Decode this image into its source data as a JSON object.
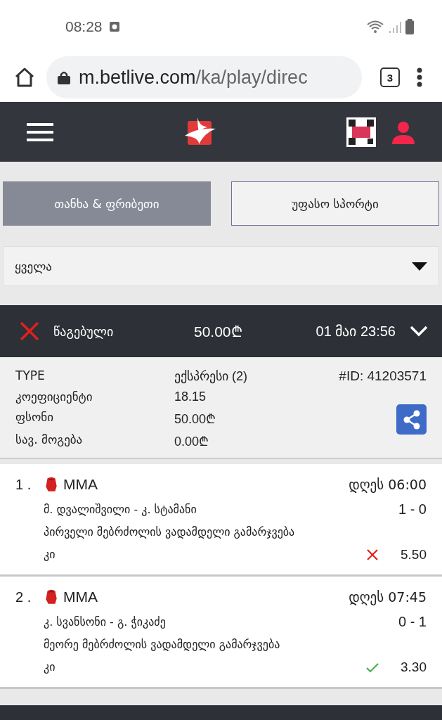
{
  "status_bar": {
    "time": "08:28"
  },
  "browser": {
    "url_host": "m.betlive.com",
    "url_path": "/ka/play/direc",
    "tab_count": "3"
  },
  "tabs": [
    {
      "label": "თანხა & ფრიბეთი",
      "selected": true
    },
    {
      "label": "უფასო სპორტი",
      "selected": false
    }
  ],
  "filter": {
    "value": "ყველა"
  },
  "bet": {
    "won": false,
    "status_label": "წაგებული",
    "amount": "50.00₾",
    "date": "01 მაი 23:56",
    "expanded": true,
    "details": [
      {
        "label": "TYPE",
        "value": "ექსპრესი (2)"
      },
      {
        "label": "კოეფიციენტი",
        "value": "18.15"
      },
      {
        "label": "ფსონი",
        "value": "50.00₾"
      },
      {
        "label": "სავ. მოგება",
        "value": "0.00₾"
      }
    ],
    "id": "#ID: 41203571",
    "selections": [
      {
        "number": "1 .",
        "sport": "MMA",
        "time": "დღეს 06:00",
        "match": "მ. დვალიშვილი - კ. სტამანი",
        "score": "1 - 0",
        "market": "პირველი მებრძოლის ვადამდელი გამარჯვება",
        "pick": "კი",
        "won": false,
        "odds": "5.50"
      },
      {
        "number": "2 .",
        "sport": "MMA",
        "time": "დღეს 07:45",
        "match": "კ. სვანსონი - გ. ჭიკაძე",
        "score": "0 - 1",
        "market": "მეორე მებრძოლის ვადამდელი გამარჯვება",
        "pick": "კი",
        "won": true,
        "odds": "3.30"
      }
    ]
  }
}
